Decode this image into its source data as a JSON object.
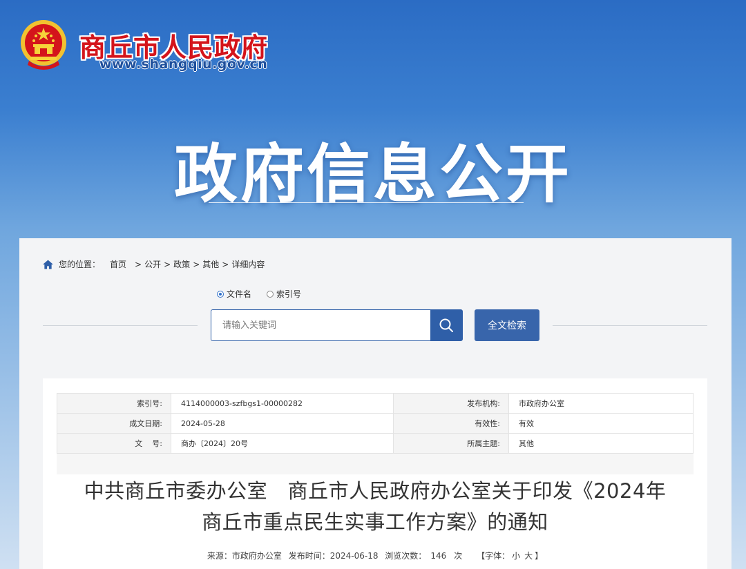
{
  "header": {
    "site_name": "商丘市人民政府",
    "site_url": "www.shangqiu.gov.cn",
    "banner_title": "政府信息公开"
  },
  "breadcrumb": {
    "prefix": "您的位置：",
    "items": [
      "首页",
      "公开",
      "政策",
      "其他",
      "详细内容"
    ],
    "separator": ">"
  },
  "search": {
    "options": [
      {
        "label": "文件名",
        "selected": true
      },
      {
        "label": "索引号",
        "selected": false
      }
    ],
    "placeholder": "请输入关键词",
    "fulltext_button": "全文检索",
    "search_icon": "search-icon"
  },
  "meta": {
    "index_no_label": "索引号:",
    "index_no": "4114000003-szfbgs1-00000282",
    "publisher_label": "发布机构:",
    "publisher": "市政府办公室",
    "created_label": "成文日期:",
    "created": "2024-05-28",
    "validity_label": "有效性:",
    "validity": "有效",
    "docno_label": "文    号:",
    "docno": "商办〔2024〕20号",
    "topic_label": "所属主题:",
    "topic": "其他"
  },
  "document": {
    "title_line1": "中共商丘市委办公室　商丘市人民政府办公室关于印发《2024年",
    "title_line2": "商丘市重点民生实事工作方案》的通知",
    "source": "来源：市政府办公室",
    "publish_time": "发布时间：2024-06-18",
    "views_label": "浏览次数：",
    "views": "146",
    "views_unit": "次",
    "font_label": "【字体：",
    "font_small": "小",
    "font_large": "大",
    "font_close": "】"
  },
  "colors": {
    "brand_red": "#d4141b",
    "brand_blue": "#2f5fa8",
    "header_blue": "#2b6cc4"
  }
}
